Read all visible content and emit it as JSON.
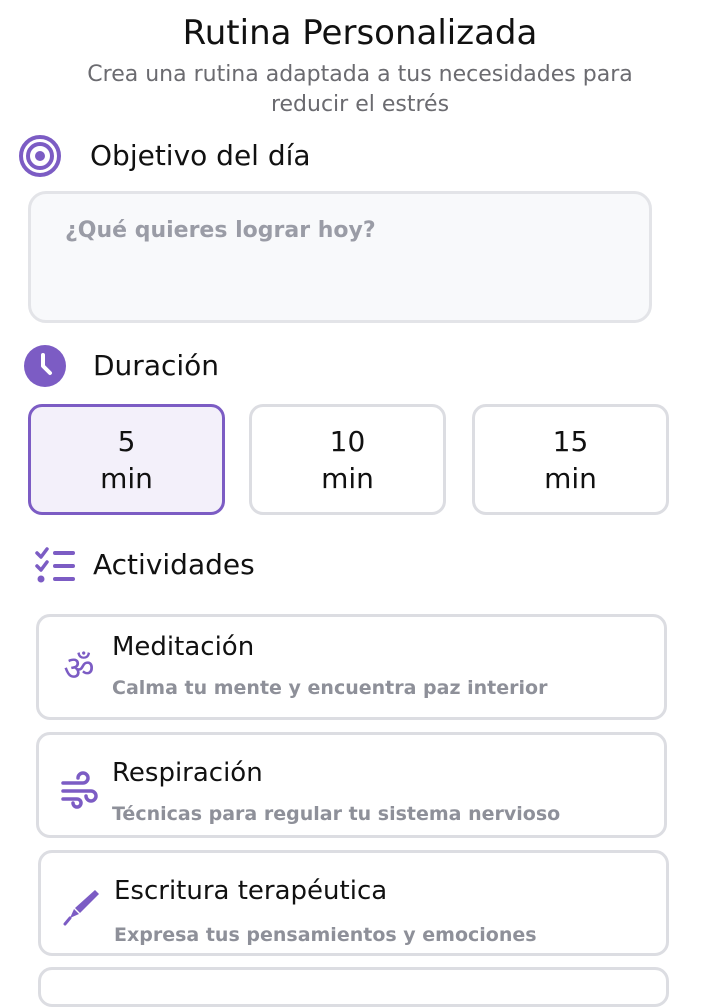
{
  "header": {
    "title": "Rutina Personalizada",
    "subtitle_line1": "Crea una rutina adaptada a tus necesidades para",
    "subtitle_line2": "reducir el estrés"
  },
  "goal": {
    "section_title": "Objetivo del día",
    "icon": "target-icon",
    "placeholder": "¿Qué quieres lograr hoy?",
    "value": ""
  },
  "duration": {
    "section_title": "Duración",
    "icon": "clock-icon",
    "options": [
      {
        "value": "5",
        "unit": "min",
        "selected": true
      },
      {
        "value": "10",
        "unit": "min",
        "selected": false
      },
      {
        "value": "15",
        "unit": "min",
        "selected": false
      }
    ]
  },
  "activities": {
    "section_title": "Actividades",
    "icon": "checklist-icon",
    "items": [
      {
        "title": "Meditación",
        "description": "Calma tu mente y encuentra paz interior",
        "icon": "om-icon"
      },
      {
        "title": "Respiración",
        "description": "Técnicas para regular tu sistema nervioso",
        "icon": "wind-icon"
      },
      {
        "title": "Escritura terapéutica",
        "description": "Expresa tus pensamientos y emociones",
        "icon": "pen-icon"
      }
    ]
  },
  "colors": {
    "accent": "#7c5cc4",
    "selected_bg": "#f3f0fa",
    "border": "#dcdde2",
    "muted_text": "#8e9099"
  }
}
